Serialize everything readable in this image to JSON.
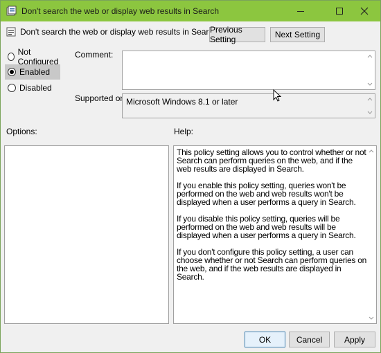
{
  "window": {
    "title": "Don't search the web or display web results in Search",
    "accent_color": "#8cc63f"
  },
  "header": {
    "policy_title": "Don't search the web or display web results in Search",
    "previous_label": "Previous Setting",
    "next_label": "Next Setting"
  },
  "state": {
    "options": [
      {
        "label": "Not Configured",
        "selected": false
      },
      {
        "label": "Enabled",
        "selected": true
      },
      {
        "label": "Disabled",
        "selected": false
      }
    ]
  },
  "comment": {
    "label": "Comment:",
    "value": ""
  },
  "supported": {
    "label": "Supported on:",
    "value": "Microsoft Windows 8.1 or later"
  },
  "options_panel": {
    "label": "Options:"
  },
  "help_panel": {
    "label": "Help:",
    "paragraphs": [
      "This policy setting allows you to control whether or not Search can perform queries on the web, and if the web results are displayed in Search.",
      "If you enable this policy setting, queries won't be performed on the web and web results won't be displayed when a user performs a query in Search.",
      "If you disable this policy setting, queries will be performed on the web and web results will be displayed when a user performs a query in Search.",
      "If you don't configure this policy setting, a user can choose whether or not Search can perform queries on the web, and if the web results are displayed in Search."
    ]
  },
  "footer": {
    "ok_label": "OK",
    "cancel_label": "Cancel",
    "apply_label": "Apply"
  }
}
